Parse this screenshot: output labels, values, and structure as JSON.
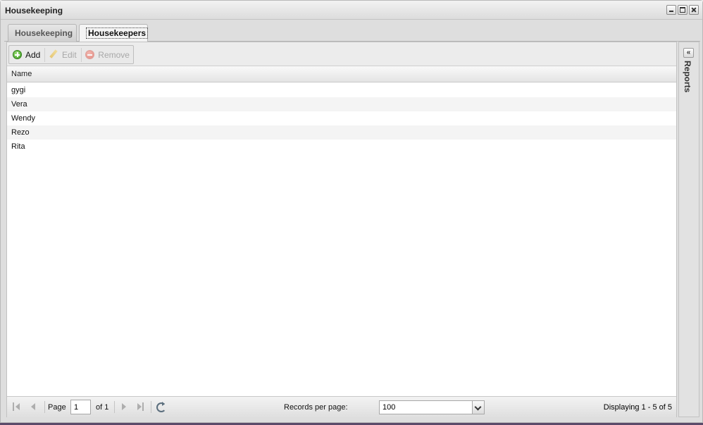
{
  "window": {
    "title": "Housekeeping"
  },
  "tabs": [
    {
      "label": "Housekeeping",
      "active": false
    },
    {
      "label": "Housekeepers",
      "active": true
    }
  ],
  "toolbar": {
    "add_label": "Add",
    "edit_label": "Edit",
    "remove_label": "Remove"
  },
  "grid": {
    "column": "Name",
    "rows": [
      "gygi",
      "Vera",
      "Wendy",
      "Rezo",
      "Rita"
    ]
  },
  "pager": {
    "page_label": "Page",
    "page_value": "1",
    "of_label": "of 1",
    "records_label": "Records per page:",
    "records_value": "100",
    "display_text": "Displaying 1 - 5 of 5"
  },
  "side_panel": {
    "title": "Reports",
    "collapse_glyph": "«"
  },
  "colors": {
    "accent": "#3a9a1e",
    "remove": "#e26a5d"
  }
}
